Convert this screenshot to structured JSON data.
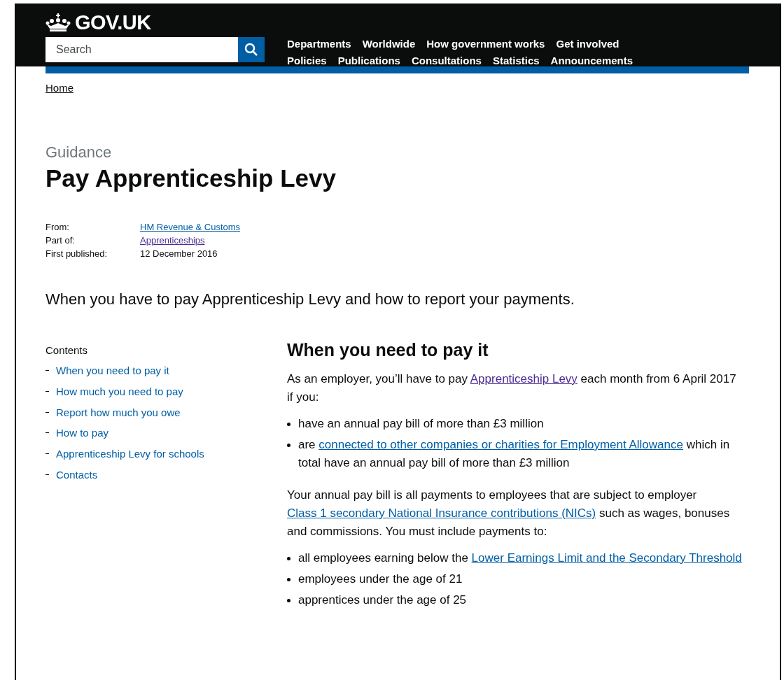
{
  "header": {
    "logo": "GOV.UK",
    "search": {
      "placeholder": "Search"
    },
    "nav_rows": [
      [
        "Departments",
        "Worldwide",
        "How government works",
        "Get involved"
      ],
      [
        "Policies",
        "Publications",
        "Consultations",
        "Statistics",
        "Announcements"
      ]
    ]
  },
  "breadcrumb": "Home",
  "document_type": "Guidance",
  "title": "Pay Apprenticeship Levy",
  "metadata": [
    {
      "label": "From:",
      "value": "HM Revenue & Customs",
      "kind": "link",
      "visited": false
    },
    {
      "label": "Part of:",
      "value": "Apprenticeships",
      "kind": "link",
      "visited": true
    },
    {
      "label": "First published:",
      "value": "12 December 2016",
      "kind": "text"
    }
  ],
  "summary": "When you have to pay Apprenticeship Levy and how to report your payments.",
  "contents": {
    "heading": "Contents",
    "items": [
      "When you need to pay it",
      "How much you need to pay",
      "Report how much you owe",
      "How to pay",
      "Apprenticeship Levy for schools",
      "Contacts"
    ]
  },
  "section": {
    "heading": "When you need to pay it",
    "blocks": [
      {
        "kind": "paragraph",
        "parts": [
          {
            "text": "As an employer, you’ll have to pay "
          },
          {
            "text": "Apprenticeship Levy",
            "link": true,
            "visited": true
          },
          {
            "text": " each month from 6 April 2017 if you:"
          }
        ]
      },
      {
        "kind": "list",
        "items": [
          [
            {
              "text": "have an annual pay bill of more than £3 million"
            }
          ],
          [
            {
              "text": "are "
            },
            {
              "text": "connected to other companies or charities for Employment Allowance",
              "link": true,
              "visited": false
            },
            {
              "text": " which in total have an annual pay bill of more than £3 million"
            }
          ]
        ]
      },
      {
        "kind": "paragraph",
        "parts": [
          {
            "text": "Your annual pay bill is all payments to employees that are subject to employer "
          },
          {
            "text": "Class 1 secondary National Insurance contributions (NICs)",
            "link": true,
            "visited": false
          },
          {
            "text": " such as wages, bonuses and commissions. You must include payments to:"
          }
        ]
      },
      {
        "kind": "list",
        "items": [
          [
            {
              "text": "all employees earning below the "
            },
            {
              "text": "Lower Earnings Limit and the Secondary Threshold",
              "link": true,
              "visited": false
            }
          ],
          [
            {
              "text": "employees under the age of 21"
            }
          ],
          [
            {
              "text": "apprentices under the age of 25"
            }
          ]
        ]
      }
    ]
  }
}
